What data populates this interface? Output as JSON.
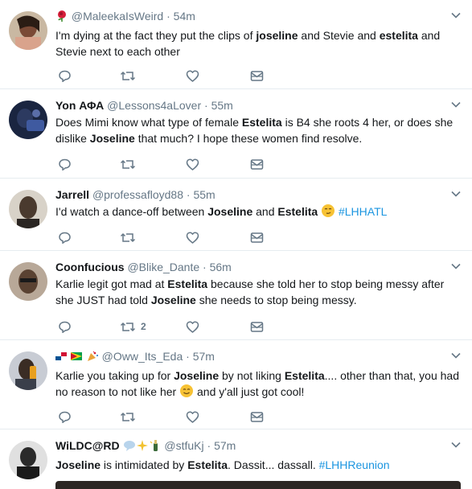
{
  "tweets": [
    {
      "name": "",
      "handle": "@MaleekaIsWeird",
      "dot": "·",
      "time": "54m",
      "text": [
        {
          "t": "I'm dying at the fact they put the clips of "
        },
        {
          "t": "joseline",
          "b": true
        },
        {
          "t": " and Stevie and "
        },
        {
          "t": "estelita",
          "b": true
        },
        {
          "t": " and Stevie next to each other"
        }
      ],
      "avatar_color": "#7a4a36",
      "reply_count": ""
    },
    {
      "name": "Yon ΑΦΑ",
      "handle": "@Lessons4aLover",
      "dot": "·",
      "time": "55m",
      "text": [
        {
          "t": "Does Mimi know what type of female "
        },
        {
          "t": "Estelita",
          "b": true
        },
        {
          "t": " is B4 she roots 4 her, or does she dislike "
        },
        {
          "t": "Joseline",
          "b": true
        },
        {
          "t": " that much? I hope these women find resolve."
        }
      ],
      "avatar_color": "#1e2a4a",
      "reply_count": ""
    },
    {
      "name": "Jarrell",
      "handle": "@professafloyd88",
      "dot": "·",
      "time": "55m",
      "text": [
        {
          "t": "I'd watch a dance-off between "
        },
        {
          "t": "Joseline",
          "b": true
        },
        {
          "t": " and "
        },
        {
          "t": "Estelita",
          "b": true
        },
        {
          "t": " "
        },
        {
          "emoji": "smirk"
        },
        {
          "t": " "
        },
        {
          "t": "#LHHATL",
          "h": true
        }
      ],
      "avatar_color": "#5b4a3c",
      "reply_count": ""
    },
    {
      "name": "Coonfucious",
      "handle": "@Blike_Dante",
      "dot": "·",
      "time": "56m",
      "text": [
        {
          "t": "Karlie legit got mad at "
        },
        {
          "t": "Estelita",
          "b": true
        },
        {
          "t": " because she told her to stop being messy after she JUST had told "
        },
        {
          "t": "Joseline",
          "b": true
        },
        {
          "t": " she needs to stop being messy."
        }
      ],
      "avatar_color": "#4a3a30",
      "retweet_count": "2"
    },
    {
      "name": "",
      "handle": "@Oww_Its_Eda",
      "dot": "·",
      "time": "57m",
      "text": [
        {
          "t": "Karlie you taking up for "
        },
        {
          "t": "Joseline",
          "b": true
        },
        {
          "t": " by not liking "
        },
        {
          "t": "Estelita",
          "b": true
        },
        {
          "t": ".... other than that, you had no reason to not like her "
        },
        {
          "emoji": "smile"
        },
        {
          "t": " and y'all just got cool!"
        }
      ],
      "avatar_color": "#3a3f4a",
      "reply_count": ""
    },
    {
      "name": "WiLDC@RD",
      "handle": "@stfuKj",
      "dot": "·",
      "time": "57m",
      "text": [
        {
          "t": "Joseline",
          "b": true
        },
        {
          "t": " is intimidated by "
        },
        {
          "t": "Estelita",
          "b": true
        },
        {
          "t": ". Dassit... dassall. "
        },
        {
          "t": "#LHHReunion",
          "h": true
        }
      ],
      "avatar_color": "#2a2a2a",
      "reply_count": ""
    }
  ],
  "colors": {
    "text": "#14171a",
    "muted": "#657786",
    "hashtag": "#1b95e0",
    "border": "#e6ecf0"
  },
  "icons": [
    "reply-icon",
    "retweet-icon",
    "like-icon",
    "message-icon",
    "chevron-down-icon"
  ]
}
